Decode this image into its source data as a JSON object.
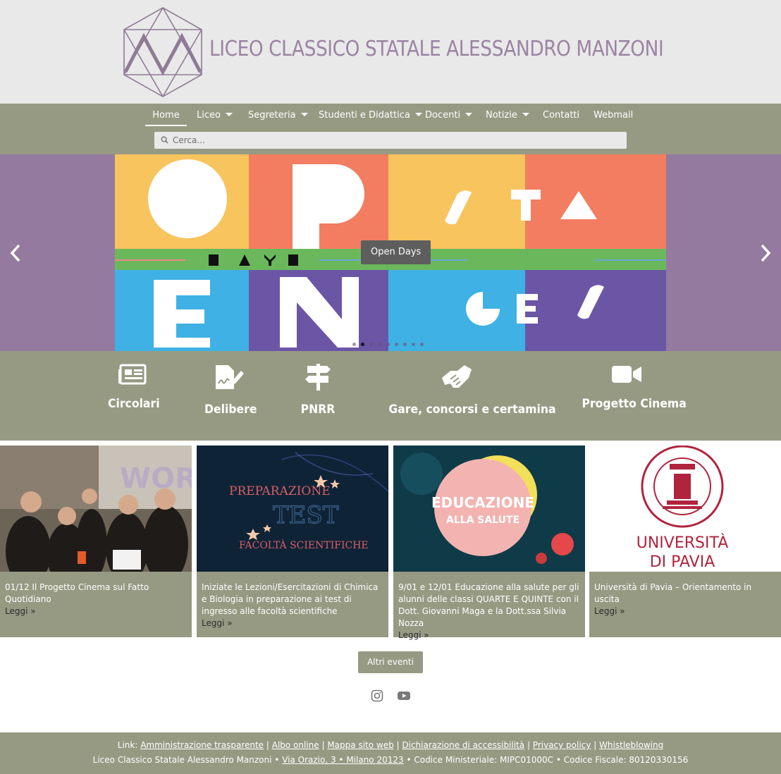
{
  "header": {
    "title": "LICEO CLASSICO STATALE ALESSANDRO MANZONI",
    "logo_icon": "icosahedron-m-logo"
  },
  "nav": {
    "items": [
      {
        "label": "Home",
        "active": true,
        "dropdown": false
      },
      {
        "label": "Liceo",
        "dropdown": true
      },
      {
        "label": "Segreteria",
        "dropdown": true
      },
      {
        "label": "Studenti e Didattica",
        "dropdown": true
      },
      {
        "label": "Docenti",
        "dropdown": true
      },
      {
        "label": "Notizie",
        "dropdown": true
      },
      {
        "label": "Contatti",
        "dropdown": false
      },
      {
        "label": "Webmail",
        "dropdown": false
      }
    ],
    "search_placeholder": "Cerca..."
  },
  "slider": {
    "caption": "Open Days",
    "banner_words": [
      "O",
      "P",
      "S T A",
      "DAYS",
      "E",
      "N",
      "G E S"
    ],
    "total_slides": 9,
    "active_index": 1
  },
  "quick_links": [
    {
      "label": "Circolari",
      "icon": "newspaper-icon"
    },
    {
      "label": "Delibere",
      "icon": "signed-document-icon"
    },
    {
      "label": "PNRR",
      "icon": "signpost-icon"
    },
    {
      "label": "Gare, concorsi e certamina",
      "icon": "handshake-icon"
    },
    {
      "label": "Progetto Cinema",
      "icon": "video-camera-icon"
    }
  ],
  "cards": [
    {
      "text": "01/12 Il Progetto Cinema sul Fatto Quotidiano",
      "read": "Leggi »"
    },
    {
      "text": "Iniziate le Lezioni/Esercitazioni di Chimica e Biologia in preparazione ai test di ingresso alle facoltà scientifiche",
      "read": "Leggi »",
      "image_text": [
        "PREPARAZIONE",
        "TEST",
        "FACOLTÀ SCIENTIFICHE"
      ]
    },
    {
      "text": "9/01 e 12/01 Educazione alla salute per gli alunni delle classi QUARTE E QUINTE con il Dott. Giovanni Maga e la Dott.ssa Silvia Nozza",
      "read": "Leggi »",
      "image_text": [
        "EDUCAZIONE",
        "ALLA SALUTE"
      ]
    },
    {
      "text": "Università di Pavia – Orientamento in uscita",
      "read": "Leggi »",
      "image_text": [
        "UNIVERSITÀ",
        "DI PAVIA"
      ]
    }
  ],
  "more_button": "Altri eventi",
  "social": [
    "instagram-icon",
    "youtube-icon"
  ],
  "footer": {
    "link_prefix": "Link:",
    "links": [
      "Amministrazione trasparente",
      "Albo online",
      "Mappa sito web",
      "Dichiarazione di accessibilità",
      "Privacy policy",
      "Whistleblowing"
    ],
    "school_name": "Liceo Classico Statale Alessandro Manzoni •",
    "address": "Via Orazio, 3 • Milano 20123",
    "codes": "• Codice Ministeriale: MIPC01000C • Codice Fiscale: 80120330156"
  },
  "colors": {
    "nav_bg": "#979a83",
    "header_bg": "#e9e9e9",
    "title_color": "#9b84a3",
    "slider_bg": "#957aa0"
  }
}
